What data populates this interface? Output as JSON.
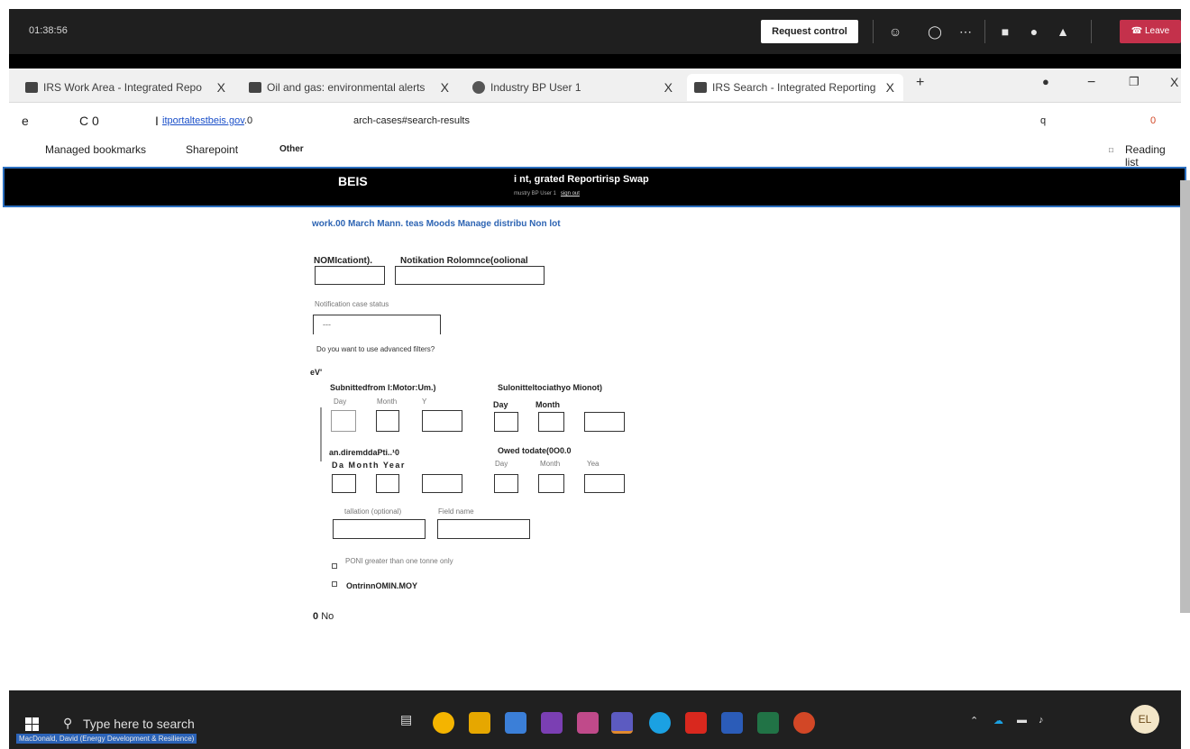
{
  "meeting": {
    "timer": "01:38:56",
    "request_control": "Request control",
    "leave": "Leave",
    "icons": [
      "people-icon",
      "chat-icon",
      "more-icon",
      "camera-off-icon",
      "mic-icon",
      "share-icon"
    ]
  },
  "tabs": [
    {
      "label": "IRS Work Area - Integrated Repo",
      "active": false
    },
    {
      "label": "Oil and gas: environmental alerts",
      "active": false
    },
    {
      "label": "Industry BP User 1",
      "active": false
    },
    {
      "label": "IRS Search - Integrated Reporting",
      "active": true
    }
  ],
  "tab_close": "X",
  "new_tab": "+",
  "window": {
    "minimize": "−",
    "restore": "❐",
    "close": "X"
  },
  "address": {
    "back": "e",
    "reload": "C 0",
    "sep": "I",
    "url_link": "itportaltestbeis.gov",
    "url_suffix": ".0",
    "url_rest": "arch-cases#search-results",
    "search_q": "q",
    "ext_count": "0"
  },
  "bookmarks": {
    "items": [
      "Managed bookmarks",
      "Sharepoint",
      "Other"
    ],
    "reading_list": "Reading list"
  },
  "header": {
    "logo": "BEIS",
    "service": "i nt, grated Reportirisp Swap",
    "user": "mustry BP User 1",
    "sign_out": "sign out"
  },
  "nav": "work.00 March Mann. teas Moods Manage distribu Non lot",
  "form": {
    "notif_label": "NOMIcationt).",
    "ref_label": "Notikation Rolomnce(oolional",
    "status_label": "Notification case status",
    "status_value": "---",
    "advanced_q": "Do you want to use advanced filters?",
    "yes": "eV'",
    "submitted_from": "Subnittedfrom I:Motor:Um.)",
    "submitted_to": "Sulonitteltociathyo Mionot)",
    "day": "Day",
    "month": "Month",
    "year": "Y",
    "day_bold": "Day",
    "month_bold": "Month",
    "incident_from": "an.diremddaPti..¹0",
    "incident_from_sub": "Da Month Year",
    "owed_to": "Owed todate(0O0.0",
    "day2": "Day",
    "month2": "Month",
    "year2": "Yea",
    "installation": "tallation (optional)",
    "field_name": "Field name",
    "poni": "PONI greater than one tonne only",
    "ontrinn": "OntrinnOMIN.MOY",
    "no_zero": "0",
    "no": "No"
  },
  "taskbar": {
    "search_placeholder": "Type here to search",
    "tooltip": "MacDonald, David (Energy Development & Resilience)",
    "avatar": "EL",
    "app_colors": [
      "#f4b400",
      "#e6a700",
      "#3b7fd8",
      "#7b3fb3",
      "#c04a8a",
      "#5c5bc1",
      "#1ba1e2",
      "#d9281e",
      "#2b5cb8",
      "#217346",
      "#d24726"
    ]
  }
}
